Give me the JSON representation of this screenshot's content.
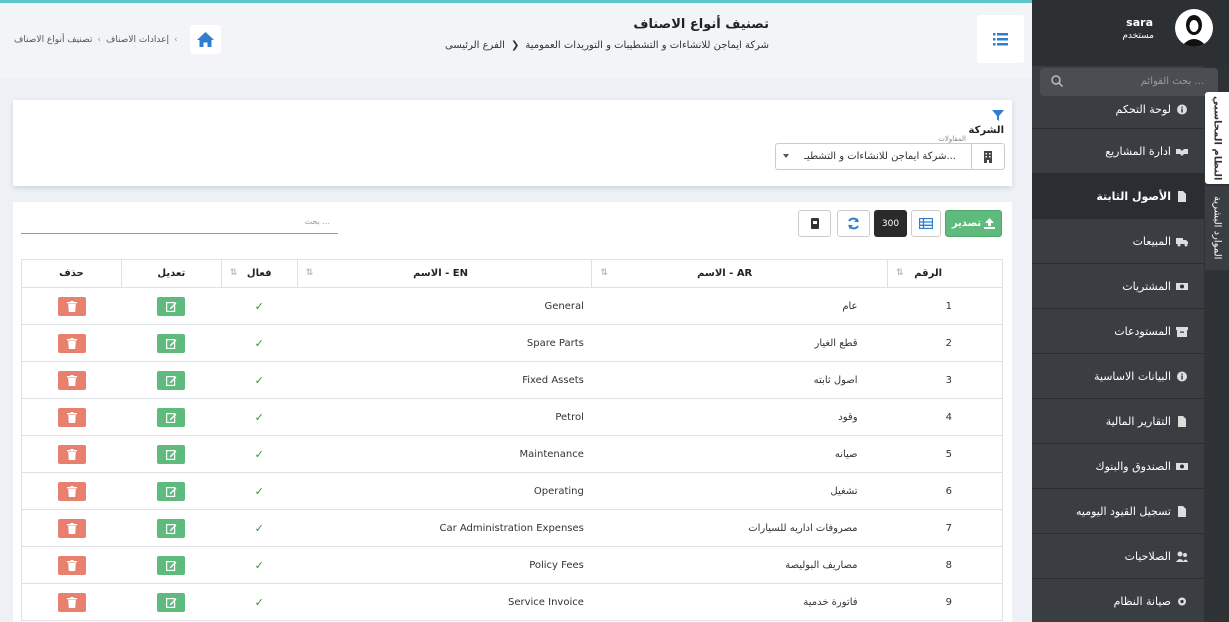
{
  "sidebar": {
    "user_name": "sara",
    "user_role": "مستخدم",
    "search_placeholder": "بحث القوائم ...",
    "vertical_tabs": [
      "النظام المحاسبي",
      "الموارد البشرية"
    ],
    "items": [
      {
        "label": "لوحة التحكم",
        "icon": "info-icon"
      },
      {
        "label": "ادارة المشاريع",
        "icon": "handshake-icon"
      },
      {
        "label": "الأصول الثابتة",
        "icon": "file-icon"
      },
      {
        "label": "المبيعات",
        "icon": "truck-icon"
      },
      {
        "label": "المشتريات",
        "icon": "money-icon"
      },
      {
        "label": "المستودعات",
        "icon": "archive-icon"
      },
      {
        "label": "البيانات الاساسية",
        "icon": "info-icon"
      },
      {
        "label": "التقارير المالية",
        "icon": "file-icon"
      },
      {
        "label": "الصندوق والبنوك",
        "icon": "money-icon"
      },
      {
        "label": "تسجيل القيود اليوميه",
        "icon": "file-icon"
      },
      {
        "label": "الصلاحيات",
        "icon": "users-icon"
      },
      {
        "label": "صيانة النظام",
        "icon": "gear-icon"
      }
    ]
  },
  "header": {
    "title": "تصنيف أنواع الاصناف",
    "company": "شركة ايماجن للانشاءات و التشطيبات و التوريدات العمومية",
    "branch": "الفرع الرئيسى",
    "breadcrumb": [
      "إعدادات الاصناف",
      "تصنيف أنواع الاصناف"
    ]
  },
  "filter": {
    "label": "الشركة",
    "float_label": "المقاولات",
    "selected": "شركة ايماجن للانشاءات و التشطيـ..."
  },
  "toolbar": {
    "export_label": "تصدير",
    "page_size": "300",
    "search_placeholder": "بحث ..."
  },
  "table": {
    "headers": {
      "num": "الرقم",
      "ar": "الاسم - AR",
      "en": "الاسم - EN",
      "active": "فعال",
      "edit": "تعديل",
      "delete": "حذف"
    },
    "rows": [
      {
        "num": "1",
        "ar": "عام",
        "en": "General",
        "active": "✓"
      },
      {
        "num": "2",
        "ar": "قطع الغيار",
        "en": "Spare Parts",
        "active": "✓"
      },
      {
        "num": "3",
        "ar": "اصول ثابته",
        "en": "Fixed Assets",
        "active": "✓"
      },
      {
        "num": "4",
        "ar": "وقود",
        "en": "Petrol",
        "active": "✓"
      },
      {
        "num": "5",
        "ar": "صيانه",
        "en": "Maintenance",
        "active": "✓"
      },
      {
        "num": "6",
        "ar": "تشغيل",
        "en": "Operating",
        "active": "✓"
      },
      {
        "num": "7",
        "ar": "مصروفات اداريه للسيارات",
        "en": "Car Administration Expenses",
        "active": "✓"
      },
      {
        "num": "8",
        "ar": "مصاريف البوليصة",
        "en": "Policy Fees",
        "active": "✓"
      },
      {
        "num": "9",
        "ar": "فاتورة خدمية",
        "en": "Service Invoice",
        "active": "✓"
      }
    ]
  },
  "colors": {
    "accent_green": "#5fba7d",
    "delete_red": "#e8806f",
    "sidebar_bg": "#2f3235",
    "top_line": "#5bc6c9"
  }
}
